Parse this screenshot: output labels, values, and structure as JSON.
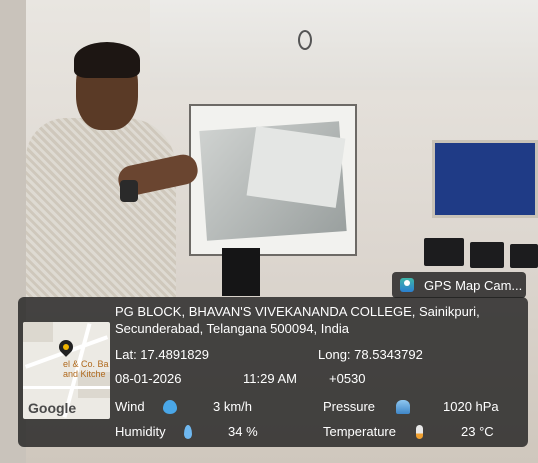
{
  "gps_badge": {
    "label": "GPS Map Cam..."
  },
  "location": {
    "line1": "PG BLOCK, BHAVAN'S VIVEKANANDA COLLEGE, Sainikpuri,",
    "line2": "Secunderabad, Telangana 500094, India"
  },
  "coords": {
    "lat": "Lat: 17.4891829",
    "long": "Long: 78.5343792"
  },
  "datetime": {
    "date": "08-01-2026",
    "time": "11:29 AM",
    "tz": "+0530"
  },
  "weather": {
    "wind_label": "Wind",
    "wind_value": "3 km/h",
    "pressure_label": "Pressure",
    "pressure_value": "1020 hPa",
    "humidity_label": "Humidity",
    "humidity_value": "34 %",
    "temperature_label": "Temperature",
    "temperature_value": "23 °C"
  },
  "map": {
    "place": "el & Co. Ba\nand Kitche",
    "logo": "Google"
  },
  "colors": {
    "overlay": "#1e1e1e",
    "pin": "#f0b400"
  }
}
